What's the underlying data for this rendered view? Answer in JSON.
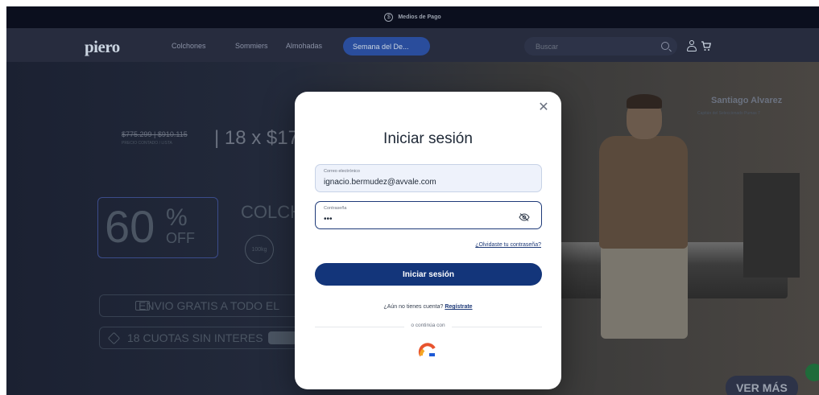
{
  "topbar": {
    "payment_text": "Medios de Pago"
  },
  "header": {
    "logo": "piero",
    "nav": [
      "Colchones",
      "Sommiers",
      "Almohadas"
    ],
    "highlight_tab": "Semana del De...",
    "search_placeholder": "Buscar"
  },
  "hero": {
    "price_old": "$775.299 | $910.115",
    "price_sub": "PRECIO CONTADO / LISTA",
    "cuotas": "| 18 x $17",
    "discount_number": "60",
    "discount_percent": "%",
    "discount_off": "OFF",
    "product_title": "COLCH",
    "badge": "100kg",
    "envio": "ENVIO GRATIS A TODO EL",
    "cuotas_sin_interes": "18 CUOTAS SIN INTERES",
    "name": "Santiago Alvarez",
    "name_sub": "Capitán del Seleccionado Pumas 7",
    "ver_mas": "VER MÁS"
  },
  "modal": {
    "title": "Iniciar sesión",
    "email_label": "Correo electrónico",
    "email_value": "ignacio.bermudez@avvale.com",
    "password_label": "Contraseña",
    "password_value": "•••",
    "forgot": "¿Olvidaste tu contraseña?",
    "login_button": "Iniciar sesión",
    "no_account": "¿Aún no tienes cuenta?",
    "register": "Regístrate",
    "or_continue": "o continúa con"
  },
  "colors": {
    "primary": "#13357a",
    "header_bg": "#272c3e",
    "topbar_bg": "#0b0f1e"
  }
}
